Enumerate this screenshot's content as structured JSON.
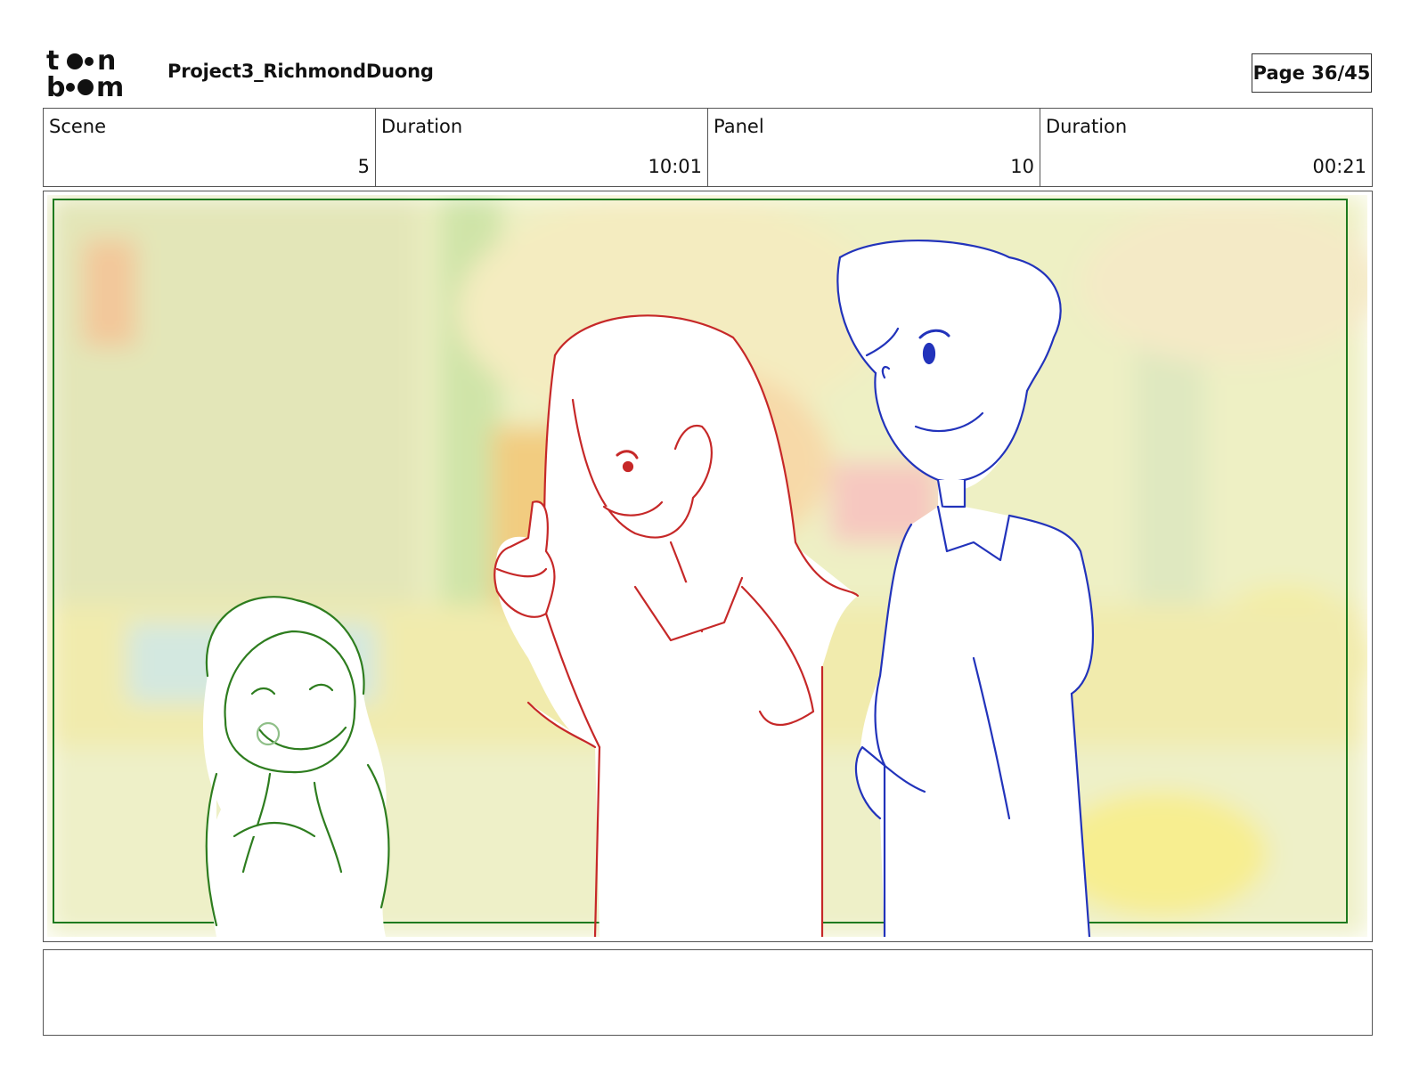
{
  "header": {
    "logo_text": [
      "to",
      "n",
      "b",
      "m"
    ],
    "project_title": "Project3_RichmondDuong",
    "page_label": "Page 36/45"
  },
  "info": [
    {
      "label": "Scene",
      "value": "5"
    },
    {
      "label": "Duration",
      "value": "10:01"
    },
    {
      "label": "Panel",
      "value": "10"
    },
    {
      "label": "Duration",
      "value": "00:21"
    }
  ],
  "panel": {
    "line_colors": {
      "frame": "#1e7a1e",
      "child": "#2e7d1f",
      "woman": "#c62828",
      "man": "#2233bb"
    }
  },
  "notes": {
    "text": ""
  }
}
